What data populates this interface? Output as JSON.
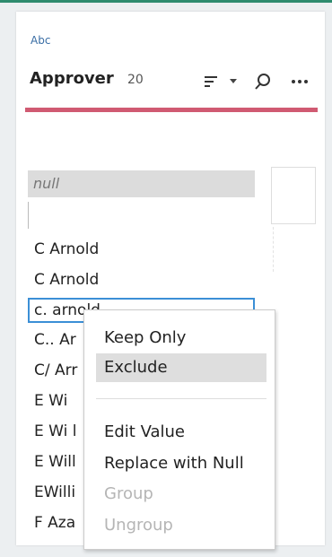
{
  "header": {
    "type_label": "Abc",
    "field_name": "Approver",
    "count": "20"
  },
  "icons": {
    "sort": "sort-icon",
    "dropdown": "caret-down-icon",
    "search": "search-icon",
    "more": "more-icon"
  },
  "colors": {
    "accent_bar": "#d05a72",
    "selection_border": "#3b8fd6",
    "top_line": "#2e8b6e"
  },
  "values": {
    "null_label": "null",
    "items": [
      "C  Arnold",
      "C Arnold",
      "c. arnold",
      "C.. Ar",
      "C/ Arr",
      "E   Wi",
      "E Wi l",
      "E Will",
      "EWilli",
      "F Aza"
    ],
    "selected_index": 2
  },
  "context_menu": {
    "keep_only": "Keep Only",
    "exclude": "Exclude",
    "edit_value": "Edit Value",
    "replace_with_null": "Replace with Null",
    "group": "Group",
    "ungroup": "Ungroup"
  }
}
